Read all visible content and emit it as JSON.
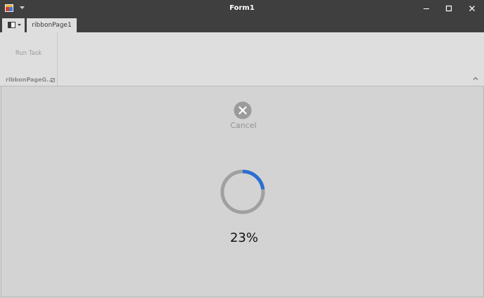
{
  "window": {
    "title": "Form1"
  },
  "ribbon": {
    "tabs": [
      {
        "label": "ribbonPage1",
        "active": true
      }
    ],
    "groups": [
      {
        "caption": "ribbonPageG...",
        "items": [
          {
            "label": "Run Task",
            "enabled": false
          }
        ]
      }
    ]
  },
  "content": {
    "cancel_label": "Cancel",
    "progress_percent": 23,
    "progress_text": "23%"
  },
  "colors": {
    "titlebar_bg": "#3f3f3f",
    "ribbon_bg": "#dedede",
    "content_bg": "#d3d3d3",
    "progress_accent": "#2b6fd3",
    "progress_track": "#a0a0a0"
  },
  "icons": {
    "app": "app-icon",
    "qat_customize": "chevron-down-icon",
    "minimize": "minimize-icon",
    "maximize": "maximize-icon",
    "close": "close-icon",
    "file_menu": "document-icon",
    "group_launcher": "dialog-launcher-icon",
    "collapse_ribbon": "chevron-up-icon",
    "cancel": "cancel-circle-icon"
  }
}
